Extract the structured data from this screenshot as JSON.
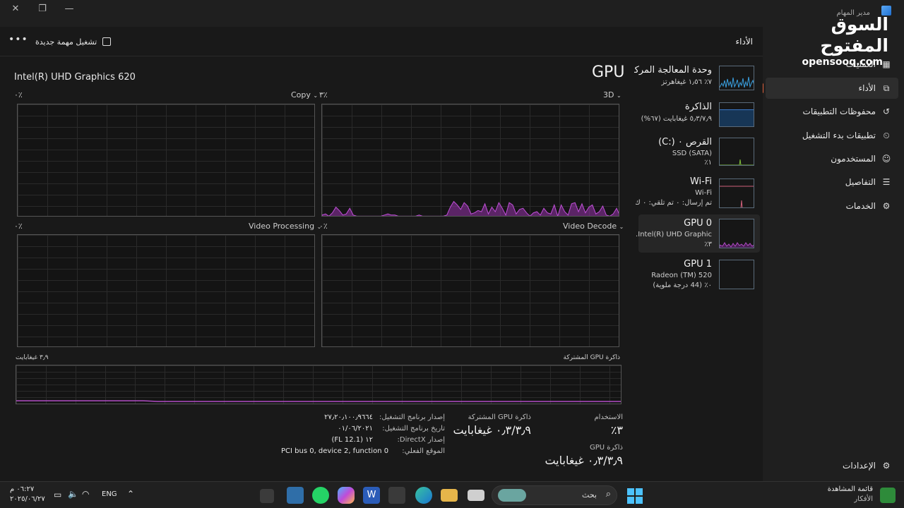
{
  "window": {
    "title": "مدير المهام",
    "minimize": "—",
    "maximize": "❐",
    "close": "✕"
  },
  "watermark": {
    "arabic": "السوق المفتوح",
    "latin": "opensooq.com"
  },
  "header": {
    "page_title": "الأداء",
    "run_new_task": "تشغيل مهمة جديدة",
    "more": "•••"
  },
  "sidebar": {
    "items": [
      {
        "label": "العمليات",
        "icon": "processes-icon"
      },
      {
        "label": "الأداء",
        "icon": "performance-icon",
        "active": true
      },
      {
        "label": "محفوظات التطبيقات",
        "icon": "history-icon"
      },
      {
        "label": "تطبيقات بدء التشغيل",
        "icon": "startup-icon"
      },
      {
        "label": "المستخدمون",
        "icon": "users-icon"
      },
      {
        "label": "التفاصيل",
        "icon": "details-icon"
      },
      {
        "label": "الخدمات",
        "icon": "services-icon"
      }
    ],
    "settings": "الإعدادات"
  },
  "resources": [
    {
      "title": "وحدة المعالجة المركزية",
      "sub1": "٧٪ ١٫٥٦ غيغاهرتز",
      "sub2": "",
      "color": "#3aa0e0"
    },
    {
      "title": "الذاكرة",
      "sub1": "٥٫٣/٧٫٩ غيغابايت (٦٧%)",
      "sub2": "",
      "color": "#3a78c8"
    },
    {
      "title": "القرص ٠ (:C)",
      "sub1": "SSD (SATA)",
      "sub2": "١٪",
      "color": "#7fbf3a"
    },
    {
      "title": "Wi-Fi",
      "sub1": "Wi-Fi",
      "sub2": "تم إرسال: ٠ تم تلقي: ٠ ك",
      "color": "#d0607a"
    },
    {
      "title": "GPU 0",
      "sub1": "Intel(R) UHD Graphic...",
      "sub2": "٣٪",
      "color": "#b04cc4",
      "active": true
    },
    {
      "title": "GPU 1",
      "sub1": "Radeon (TM) 520",
      "sub2": "٠٪ (44 درجة ملوية)",
      "color": "#b04cc4"
    }
  ],
  "gpu": {
    "title": "GPU",
    "model": "Intel(R) UHD Graphics 620",
    "engines": [
      {
        "name": "3D",
        "pct": "٣٪"
      },
      {
        "name": "Copy",
        "pct": "٠٪"
      },
      {
        "name": "Video Decode",
        "pct": "٠٪"
      },
      {
        "name": "Video Processing",
        "pct": "٠٪"
      }
    ],
    "shared_memory_label": "ذاكرة GPU المشتركة",
    "shared_memory_max": "٣٫٩ غيغابايت",
    "threed_samples": [
      2,
      3,
      1,
      4,
      9,
      6,
      2,
      3,
      8,
      2,
      1,
      1,
      1,
      1,
      1,
      1,
      1,
      1,
      2,
      3,
      2,
      2,
      1,
      1,
      1,
      1,
      1,
      1,
      2,
      1,
      1,
      1,
      1,
      1,
      1,
      1,
      2,
      9,
      14,
      11,
      7,
      13,
      10,
      3,
      4,
      6,
      5,
      12,
      3,
      9,
      5,
      13,
      8,
      2,
      13,
      11,
      3,
      7,
      8,
      4,
      1,
      4,
      5,
      2,
      8,
      4,
      3,
      11,
      1,
      11,
      5,
      2,
      12,
      13,
      5,
      12,
      4,
      9,
      11,
      3,
      5,
      10,
      2,
      1,
      3,
      8,
      1
    ]
  },
  "stats": {
    "utilization_label": "الاستخدام",
    "utilization": "٣٪",
    "shared_gpu_label": "ذاكرة GPU المشتركة",
    "shared_gpu": "٠٫٣/٣٫٩ غيغابايت",
    "gpu_mem_label": "ذاكرة GPU",
    "gpu_mem": "٠٫٣/٣٫٩ غيغابايت",
    "driver_version_label": "إصدار برنامج التشغيل:",
    "driver_version": "٢٧٫٢٠٫١٠٠٫٩٦٦٤",
    "driver_date_label": "تاريخ برنامج التشغيل:",
    "driver_date": "٠١/٠٦/٢٠٢١",
    "directx_label": "إصدار DirectX:",
    "directx": "١٢ (FL 12.1)",
    "location_label": "الموقع الفعلي:",
    "location": "PCI bus 0, device 2, function 0"
  },
  "taskbar": {
    "search": "بحث",
    "lang": "ENG",
    "time": "٠٦:٢٧ م",
    "date": "٢٠٢٥/٠٦/٢٧",
    "widget_title": "قائمة المشاهدة",
    "widget_sub": "الأفكار"
  }
}
